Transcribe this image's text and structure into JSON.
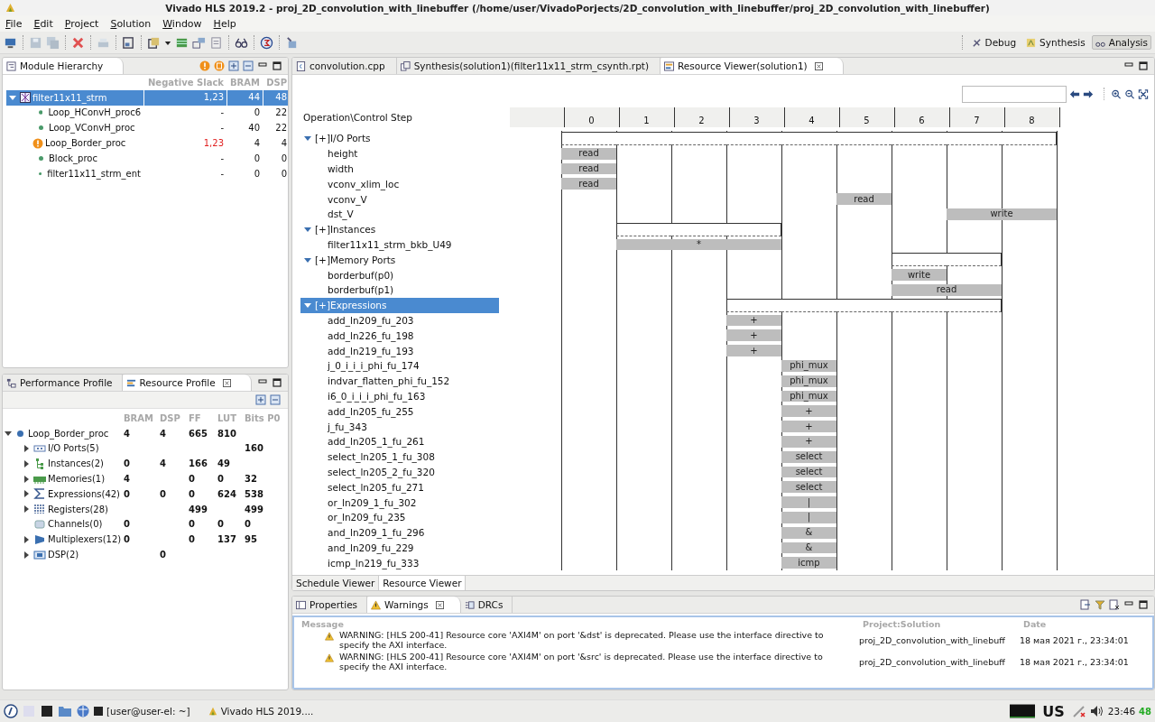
{
  "window": {
    "title": "Vivado HLS 2019.2 - proj_2D_convolution_with_linebuffer (/home/user/VivadoPorjects/2D_convolution_with_linebuffer/proj_2D_convolution_with_linebuffer)"
  },
  "menu": [
    "File",
    "Edit",
    "Project",
    "Solution",
    "Window",
    "Help"
  ],
  "perspectives": [
    {
      "label": "Debug",
      "selected": false
    },
    {
      "label": "Synthesis",
      "selected": false
    },
    {
      "label": "Analysis",
      "selected": true
    }
  ],
  "module_hierarchy": {
    "title": "Module Hierarchy",
    "columns": [
      "Negative Slack",
      "BRAM",
      "DSP"
    ],
    "root": {
      "name": "filter11x11_strm",
      "expanded": true,
      "selected": true,
      "slack": "1,23",
      "bram": "44",
      "dsp": "48",
      "children": [
        {
          "name": "Loop_HConvH_proc6",
          "violation": false,
          "selected": false,
          "slack": "-",
          "bram": "0",
          "dsp": "22"
        },
        {
          "name": "Loop_VConvH_proc",
          "violation": false,
          "selected": false,
          "slack": "-",
          "bram": "40",
          "dsp": "22"
        },
        {
          "name": "Loop_Border_proc",
          "violation": true,
          "selected": false,
          "slack": "1,23",
          "bram": "4",
          "dsp": "4"
        },
        {
          "name": "Block_proc",
          "violation": false,
          "selected": false,
          "slack": "-",
          "bram": "0",
          "dsp": "0"
        },
        {
          "name": "filter11x11_strm_ent",
          "violation": false,
          "selected": false,
          "slack": "-",
          "bram": "0",
          "dsp": "0"
        }
      ]
    }
  },
  "profile_tabs": [
    {
      "label": "Performance Profile",
      "selected": false
    },
    {
      "label": "Resource Profile",
      "selected": true
    }
  ],
  "resource_profile": {
    "columns": [
      "BRAM",
      "DSP",
      "FF",
      "LUT",
      "Bits P0"
    ],
    "root": {
      "name": "Loop_Border_proc",
      "expanded": true,
      "bram": "4",
      "dsp": "4",
      "ff": "665",
      "lut": "810",
      "children": [
        {
          "name": "I/O Ports(5)",
          "kind": "ports",
          "expandable": true,
          "bits": "160"
        },
        {
          "name": "Instances(2)",
          "kind": "instances",
          "expandable": true,
          "bram": "0",
          "dsp": "4",
          "ff": "166",
          "lut": "49"
        },
        {
          "name": "Memories(1)",
          "kind": "memories",
          "expandable": true,
          "bram": "4",
          "ff": "0",
          "lut": "0",
          "bits": "32"
        },
        {
          "name": "Expressions(42)",
          "kind": "expressions",
          "expandable": true,
          "bram": "0",
          "dsp": "0",
          "ff": "0",
          "lut": "624",
          "bits": "538"
        },
        {
          "name": "Registers(28)",
          "kind": "registers",
          "expandable": true,
          "ff": "499",
          "bits": "499"
        },
        {
          "name": "Channels(0)",
          "kind": "channels",
          "expandable": false,
          "bram": "0",
          "ff": "0",
          "lut": "0",
          "bits": "0"
        },
        {
          "name": "Multiplexers(12)",
          "kind": "multiplexers",
          "expandable": true,
          "bram": "0",
          "ff": "0",
          "lut": "137",
          "bits": "95"
        },
        {
          "name": "DSP(2)",
          "kind": "dsp",
          "expandable": true,
          "dsp": "0"
        }
      ]
    }
  },
  "editor_tabs": [
    {
      "label": "convolution.cpp",
      "kind": "source",
      "selected": false
    },
    {
      "label": "Synthesis(solution1)(filter11x11_strm_csynth.rpt)",
      "kind": "report",
      "selected": false
    },
    {
      "label": "Resource Viewer(solution1)",
      "kind": "viewer",
      "selected": true
    }
  ],
  "resource_viewer": {
    "header": "Operation\\Control Step",
    "steps": [
      "0",
      "1",
      "2",
      "3",
      "4",
      "5",
      "6",
      "7",
      "8"
    ],
    "rows": [
      {
        "name": "[+]I/O Ports",
        "kind": "group",
        "expanded": true,
        "selected": false,
        "occupied": [
          true,
          true,
          true,
          true,
          true,
          true,
          true,
          true,
          true
        ]
      },
      {
        "name": "height",
        "kind": "op",
        "label": "read",
        "occupied": [
          true,
          false,
          false,
          false,
          false,
          false,
          false,
          false,
          false
        ]
      },
      {
        "name": "width",
        "kind": "op",
        "label": "read",
        "occupied": [
          true,
          false,
          false,
          false,
          false,
          false,
          false,
          false,
          false
        ]
      },
      {
        "name": "vconv_xlim_loc",
        "kind": "op",
        "label": "read",
        "occupied": [
          true,
          false,
          false,
          false,
          false,
          false,
          false,
          false,
          false
        ]
      },
      {
        "name": "vconv_V",
        "kind": "op",
        "label": "read",
        "occupied": [
          false,
          false,
          false,
          false,
          false,
          true,
          false,
          false,
          false
        ]
      },
      {
        "name": "dst_V",
        "kind": "op",
        "label": "write",
        "occupied": [
          false,
          false,
          false,
          false,
          false,
          false,
          false,
          true,
          true
        ]
      },
      {
        "name": "[+]Instances",
        "kind": "group",
        "expanded": true,
        "selected": false,
        "occupied": [
          false,
          true,
          true,
          true,
          false,
          false,
          false,
          false,
          false
        ]
      },
      {
        "name": "filter11x11_strm_bkb_U49",
        "kind": "op",
        "label": "*",
        "occupied": [
          false,
          true,
          true,
          true,
          false,
          false,
          false,
          false,
          false
        ]
      },
      {
        "name": "[+]Memory Ports",
        "kind": "group",
        "expanded": true,
        "selected": false,
        "occupied": [
          false,
          false,
          false,
          false,
          false,
          false,
          true,
          true,
          false
        ]
      },
      {
        "name": "borderbuf(p0)",
        "kind": "op",
        "label": "write",
        "occupied": [
          false,
          false,
          false,
          false,
          false,
          false,
          true,
          false,
          false
        ]
      },
      {
        "name": "borderbuf(p1)",
        "kind": "op",
        "label": "read",
        "occupied": [
          false,
          false,
          false,
          false,
          false,
          false,
          true,
          true,
          false
        ]
      },
      {
        "name": "[+]Expressions",
        "kind": "group",
        "expanded": true,
        "selected": true,
        "occupied": [
          false,
          false,
          false,
          true,
          true,
          true,
          true,
          true,
          false
        ]
      },
      {
        "name": "add_ln209_fu_203",
        "kind": "op",
        "label": "+",
        "occupied": [
          false,
          false,
          false,
          true,
          false,
          false,
          false,
          false,
          false
        ]
      },
      {
        "name": "add_ln226_fu_198",
        "kind": "op",
        "label": "+",
        "occupied": [
          false,
          false,
          false,
          true,
          false,
          false,
          false,
          false,
          false
        ]
      },
      {
        "name": "add_ln219_fu_193",
        "kind": "op",
        "label": "+",
        "occupied": [
          false,
          false,
          false,
          true,
          false,
          false,
          false,
          false,
          false
        ]
      },
      {
        "name": "j_0_i_i_i_phi_fu_174",
        "kind": "op",
        "label": "phi_mux",
        "occupied": [
          false,
          false,
          false,
          false,
          true,
          false,
          false,
          false,
          false
        ]
      },
      {
        "name": "indvar_flatten_phi_fu_152",
        "kind": "op",
        "label": "phi_mux",
        "occupied": [
          false,
          false,
          false,
          false,
          true,
          false,
          false,
          false,
          false
        ]
      },
      {
        "name": "i6_0_i_i_i_phi_fu_163",
        "kind": "op",
        "label": "phi_mux",
        "occupied": [
          false,
          false,
          false,
          false,
          true,
          false,
          false,
          false,
          false
        ]
      },
      {
        "name": "add_ln205_fu_255",
        "kind": "op",
        "label": "+",
        "occupied": [
          false,
          false,
          false,
          false,
          true,
          false,
          false,
          false,
          false
        ]
      },
      {
        "name": "j_fu_343",
        "kind": "op",
        "label": "+",
        "occupied": [
          false,
          false,
          false,
          false,
          true,
          false,
          false,
          false,
          false
        ]
      },
      {
        "name": "add_ln205_1_fu_261",
        "kind": "op",
        "label": "+",
        "occupied": [
          false,
          false,
          false,
          false,
          true,
          false,
          false,
          false,
          false
        ]
      },
      {
        "name": "select_ln205_1_fu_308",
        "kind": "op",
        "label": "select",
        "occupied": [
          false,
          false,
          false,
          false,
          true,
          false,
          false,
          false,
          false
        ]
      },
      {
        "name": "select_ln205_2_fu_320",
        "kind": "op",
        "label": "select",
        "occupied": [
          false,
          false,
          false,
          false,
          true,
          false,
          false,
          false,
          false
        ]
      },
      {
        "name": "select_ln205_fu_271",
        "kind": "op",
        "label": "select",
        "occupied": [
          false,
          false,
          false,
          false,
          true,
          false,
          false,
          false,
          false
        ]
      },
      {
        "name": "or_ln209_1_fu_302",
        "kind": "op",
        "label": "|",
        "occupied": [
          false,
          false,
          false,
          false,
          true,
          false,
          false,
          false,
          false
        ]
      },
      {
        "name": "or_ln209_fu_235",
        "kind": "op",
        "label": "|",
        "occupied": [
          false,
          false,
          false,
          false,
          true,
          false,
          false,
          false,
          false
        ]
      },
      {
        "name": "and_ln209_1_fu_296",
        "kind": "op",
        "label": "&",
        "occupied": [
          false,
          false,
          false,
          false,
          true,
          false,
          false,
          false,
          false
        ]
      },
      {
        "name": "and_ln209_fu_229",
        "kind": "op",
        "label": "&",
        "occupied": [
          false,
          false,
          false,
          false,
          true,
          false,
          false,
          false,
          false
        ]
      },
      {
        "name": "icmp_ln219_fu_333",
        "kind": "op",
        "label": "icmp",
        "occupied": [
          false,
          false,
          false,
          false,
          true,
          false,
          false,
          false,
          false
        ]
      }
    ]
  },
  "viewer_tabs": [
    {
      "label": "Schedule Viewer",
      "selected": false
    },
    {
      "label": "Resource Viewer",
      "selected": true
    }
  ],
  "bottom_tabs": [
    {
      "label": "Properties",
      "kind": "properties",
      "selected": false
    },
    {
      "label": "Warnings",
      "kind": "warnings",
      "selected": true
    },
    {
      "label": "DRCs",
      "kind": "drcs",
      "selected": false
    }
  ],
  "warnings": {
    "columns": [
      "Message",
      "Project:Solution",
      "Date"
    ],
    "rows": [
      {
        "message": "WARNING: [HLS 200-41] Resource core 'AXI4M' on port '&dst' is deprecated. Please use the interface directive to specify the AXI interface.",
        "project": "proj_2D_convolution_with_linebuff",
        "date": "18 мая 2021 г., 23:34:01"
      },
      {
        "message": "WARNING: [HLS 200-41] Resource core 'AXI4M' on port '&src' is deprecated. Please use the interface directive to specify the AXI interface.",
        "project": "proj_2D_convolution_with_linebuff",
        "date": "18 мая 2021 г., 23:34:01"
      }
    ]
  },
  "taskbar": {
    "terminal": "[user@user-el: ~]",
    "app": "Vivado HLS 2019....",
    "keyboard": "US",
    "clock": "23:46",
    "battery": "48"
  }
}
